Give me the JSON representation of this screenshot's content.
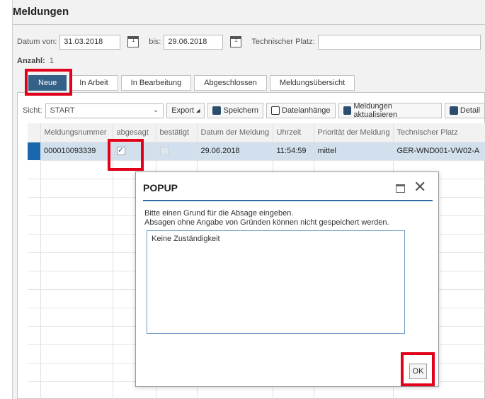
{
  "page": {
    "title": "Meldungen"
  },
  "filters": {
    "from_label": "Datum von:",
    "from_value": "31.03.2018",
    "to_label": "bis:",
    "to_value": "29.06.2018",
    "tech_label": "Technischer Platz:",
    "tech_value": ""
  },
  "count": {
    "label": "Anzahl:",
    "value": "1"
  },
  "tabs": [
    {
      "label": "Neue"
    },
    {
      "label": "In Arbeit"
    },
    {
      "label": "In Bearbeitung"
    },
    {
      "label": "Abgeschlossen"
    },
    {
      "label": "Meldungsübersicht"
    }
  ],
  "toolbar": {
    "view_label": "Sicht:",
    "view_value": "START",
    "export": "Export",
    "save": "Speichern",
    "attachments": "Dateianhänge",
    "refresh": "Meldungen aktualisieren",
    "detail": "Detail"
  },
  "table": {
    "headers": [
      "Meldungsnummer",
      "abgesagt",
      "bestätigt",
      "Datum der Meldung",
      "Uhrzeit",
      "Priorität der Meldung",
      "Technischer Platz"
    ],
    "rows": [
      {
        "number": "000010093339",
        "cancelled": "✓",
        "date": "29.06.2018",
        "time": "11:54:59",
        "priority": "mittel",
        "place": "GER-WND001-VW02-A"
      }
    ]
  },
  "popup": {
    "title": "POPUP",
    "line1": "Bitte einen Grund für die Absage eingeben.",
    "line2": "Absagen ohne Angabe von Gründen können nicht gespeichert werden.",
    "reason": "Keine Zuständigkeit",
    "ok": "OK"
  },
  "colors": {
    "accent": "#346187",
    "highlight": "#e2001a",
    "selection": "#d2dfec"
  }
}
